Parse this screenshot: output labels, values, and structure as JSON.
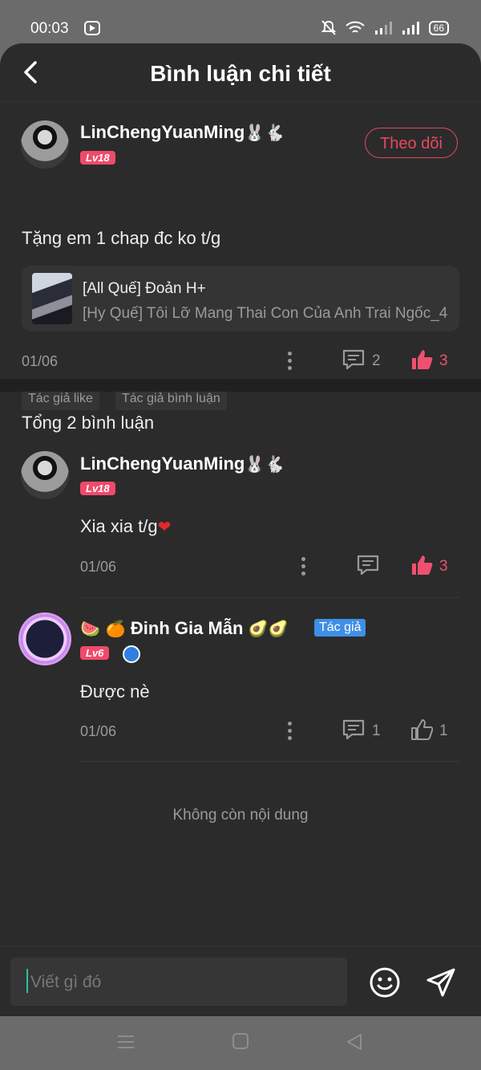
{
  "status": {
    "time": "00:03",
    "battery": "66"
  },
  "header": {
    "title": "Bình luận chi tiết"
  },
  "main_comment": {
    "username": "LinChengYuanMing",
    "emoji": "🐰🐇",
    "level": "Lv18",
    "follow_label": "Theo dõi",
    "text": "Tặng em 1 chap đc ko t/g",
    "story": {
      "title": "[All Quế] Đoản H+",
      "subtitle": "[Hy Quế] Tôi Lỡ Mang Thai Con Của Anh Trai Ngốc_4"
    },
    "date": "01/06",
    "reply_count": "2",
    "like_count": "3",
    "tags": [
      "Tác giả like",
      "Tác giả bình luận"
    ]
  },
  "total_label": "Tổng 2 bình luận",
  "replies": [
    {
      "username": "LinChengYuanMing",
      "emoji": "🐰🐇",
      "level": "Lv18",
      "text": "Xia xia t/g",
      "text_emoji": "❤",
      "date": "01/06",
      "like_count": "3"
    },
    {
      "name_prefix": "🍉 🍊",
      "username": "Đinh Gia Mẫn",
      "name_suffix": "🥑🥑",
      "author_badge": "Tác giả",
      "level": "Lv6",
      "text": "Được nè",
      "date": "01/06",
      "reply_count": "1",
      "like_count": "1"
    }
  ],
  "end_text": "Không còn nội dung",
  "input": {
    "placeholder": "Viết gì đó"
  },
  "colors": {
    "accent": "#f0506e",
    "author_badge": "#3e8fe6",
    "background": "#2b2b2b"
  }
}
